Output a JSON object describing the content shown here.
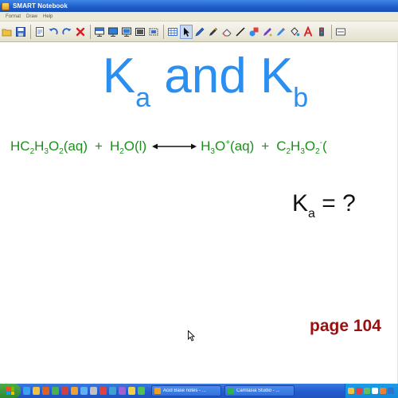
{
  "window": {
    "title": "SMART Notebook"
  },
  "menu": {
    "items": [
      "Format",
      "Draw",
      "Help"
    ]
  },
  "toolbar": {
    "icons": [
      "open-folder-icon",
      "save-icon",
      "separator",
      "page-icon",
      "undo-icon",
      "redo-icon",
      "delete-icon",
      "separator",
      "screen-shade-icon",
      "display-icon",
      "document-camera-icon",
      "insert-picture-icon",
      "capture-icon",
      "separator",
      "table-icon",
      "select-pointer-icon",
      "pen-icon",
      "creative-pen-icon",
      "eraser-icon",
      "line-icon",
      "shape-icon",
      "magic-pen-icon",
      "shape-recognition-pen-icon",
      "fill-icon",
      "text-icon",
      "properties-icon",
      "move-toolbar-icon"
    ]
  },
  "slide": {
    "title_main": "K",
    "title_sub_a": "a",
    "title_and": " and K",
    "title_sub_b": "b",
    "equation": {
      "r1": "HC",
      "r1_s1": "2",
      "r1_b": "H",
      "r1_s2": "3",
      "r1_c": "O",
      "r1_s3": "2",
      "r1_d": "(aq)",
      "plus1": "+",
      "r2": "H",
      "r2_s1": "2",
      "r2_b": "O(l)",
      "p1": "H",
      "p1_s1": "3",
      "p1_b": "O",
      "p1_sup": "+",
      "p1_c": "(aq)",
      "plus2": "+",
      "p2": "C",
      "p2_s1": "2",
      "p2_b": "H",
      "p2_s2": "3",
      "p2_c": "O",
      "p2_s3": "2",
      "p2_sup": "-",
      "p2_d": "("
    },
    "question": {
      "k": "K",
      "sub": "a",
      "rest": " = ?"
    },
    "page_ref": "page 104"
  },
  "colors": {
    "title_blue": "#2b8ff0",
    "equation_green": "#1c8f1c",
    "page_ref_red": "#9a1010",
    "taskbar_blue": "#245dd0"
  },
  "taskbar": {
    "quick_launch_icons": [
      "ie-icon",
      "folder-icon",
      "media-icon",
      "mail-icon",
      "app-icon",
      "app-icon",
      "app-icon",
      "app-icon",
      "app-icon",
      "app-icon",
      "app-icon",
      "app-icon",
      "app-icon"
    ],
    "tasks": [
      {
        "label": "Acid Base notes - ...",
        "icon": "smart-notebook-icon"
      },
      {
        "label": "Camtasia Studio - ...",
        "icon": "camtasia-icon"
      }
    ],
    "tray_icons": [
      "tray-icon-1",
      "tray-icon-2",
      "tray-icon-3",
      "tray-icon-4",
      "tray-icon-5",
      "tray-icon-6"
    ]
  }
}
